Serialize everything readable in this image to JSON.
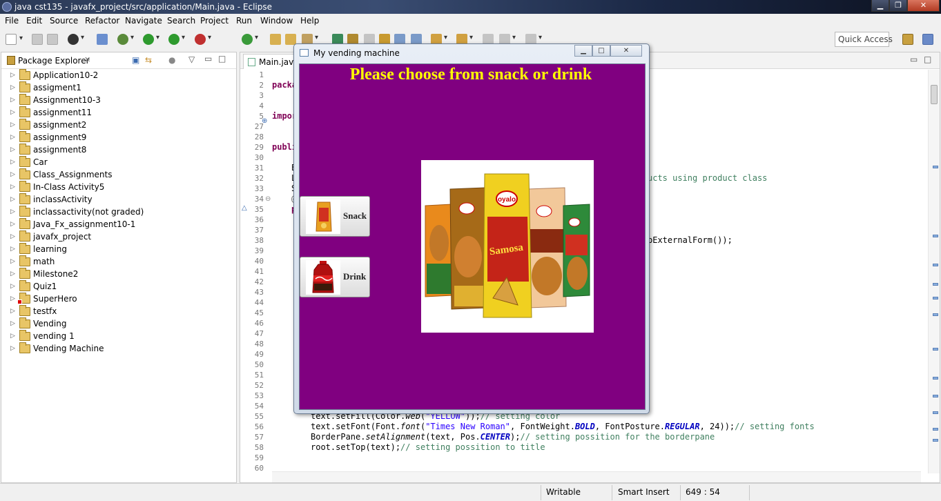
{
  "window": {
    "title": "java cst135 - javafx_project/src/application/Main.java - Eclipse"
  },
  "menu": [
    "File",
    "Edit",
    "Source",
    "Refactor",
    "Navigate",
    "Search",
    "Project",
    "Run",
    "Window",
    "Help"
  ],
  "toolbar": {
    "quick_access_label": "Quick Access"
  },
  "package_explorer": {
    "title": "Package Explorer",
    "items": [
      {
        "label": "Application10-2",
        "error": false
      },
      {
        "label": "assigment1",
        "error": false
      },
      {
        "label": "Assignment10-3",
        "error": false
      },
      {
        "label": "assignment11",
        "error": false
      },
      {
        "label": "assignment2",
        "error": false
      },
      {
        "label": "assignment9",
        "error": false
      },
      {
        "label": "assignment8",
        "error": false
      },
      {
        "label": "Car",
        "error": false
      },
      {
        "label": "Class_Assignments",
        "error": false
      },
      {
        "label": "In-Class Activity5",
        "error": false
      },
      {
        "label": "inclassActivity",
        "error": false
      },
      {
        "label": "inclassactivity(not graded)",
        "error": false
      },
      {
        "label": "Java_Fx_assignment10-1",
        "error": false
      },
      {
        "label": "javafx_project",
        "error": false
      },
      {
        "label": "learning",
        "error": false
      },
      {
        "label": "math",
        "error": false
      },
      {
        "label": "Milestone2",
        "error": false
      },
      {
        "label": "Quiz1",
        "error": false
      },
      {
        "label": "SuperHero",
        "error": true
      },
      {
        "label": "testfx",
        "error": false
      },
      {
        "label": "Vending",
        "error": false
      },
      {
        "label": "vending 1",
        "error": false
      },
      {
        "label": "Vending Machine",
        "error": false
      }
    ]
  },
  "editor": {
    "tab_label": "Main.java",
    "line_numbers": [
      "1",
      "2",
      "3",
      "4",
      "5",
      "27",
      "28",
      "29",
      "30",
      "31",
      "32",
      "33",
      "34",
      "35",
      "36",
      "37",
      "38",
      "39",
      "40",
      "41",
      "42",
      "43",
      "44",
      "45",
      "46",
      "47",
      "48",
      "49",
      "50",
      "51",
      "52",
      "53",
      "54",
      "55",
      "56",
      "57",
      "58",
      "59",
      "60"
    ],
    "code": {
      "l2": "packa",
      "l5": "impor",
      "l29": "publi",
      "l31": "E",
      "l32": "L",
      "l33": "S",
      "l34": "@",
      "l35": "p",
      "l32_tail": "ucts using product class",
      "l38_tail": "bExternalForm());",
      "l55a": "text.setFill(Color.",
      "l55b": "web",
      "l55c": "(",
      "l55d": "\"YELLOW\"",
      "l55e": "));",
      "l55f": "// setting color",
      "l56a": "text.setFont(Font.",
      "l56b": "font",
      "l56c": "(",
      "l56d": "\"Times New Roman\"",
      "l56e": ", FontWeight.",
      "l56f": "BOLD",
      "l56g": ", FontPosture.",
      "l56h": "REGULAR",
      "l56i": ", 24));",
      "l56j": "// setting fonts",
      "l57a": "BorderPane.",
      "l57b": "setAlignment",
      "l57c": "(text, Pos.",
      "l57d": "CENTER",
      "l57e": ");",
      "l57f": "// setting possition for the borderpane",
      "l58a": "root.setTop(text);",
      "l58b": "// setting possition to title"
    }
  },
  "dialog": {
    "title": "My vending machine",
    "headline": "Please choose from snack or drink",
    "snack_label": "Snack",
    "drink_label": "Drink",
    "brand_label": "oyalo",
    "samosa_label": "Samosa",
    "colors": {
      "background": "#800080",
      "headline": "#ffff00"
    }
  },
  "status": {
    "writable": "Writable",
    "insert_mode": "Smart Insert",
    "position": "649 : 54"
  }
}
